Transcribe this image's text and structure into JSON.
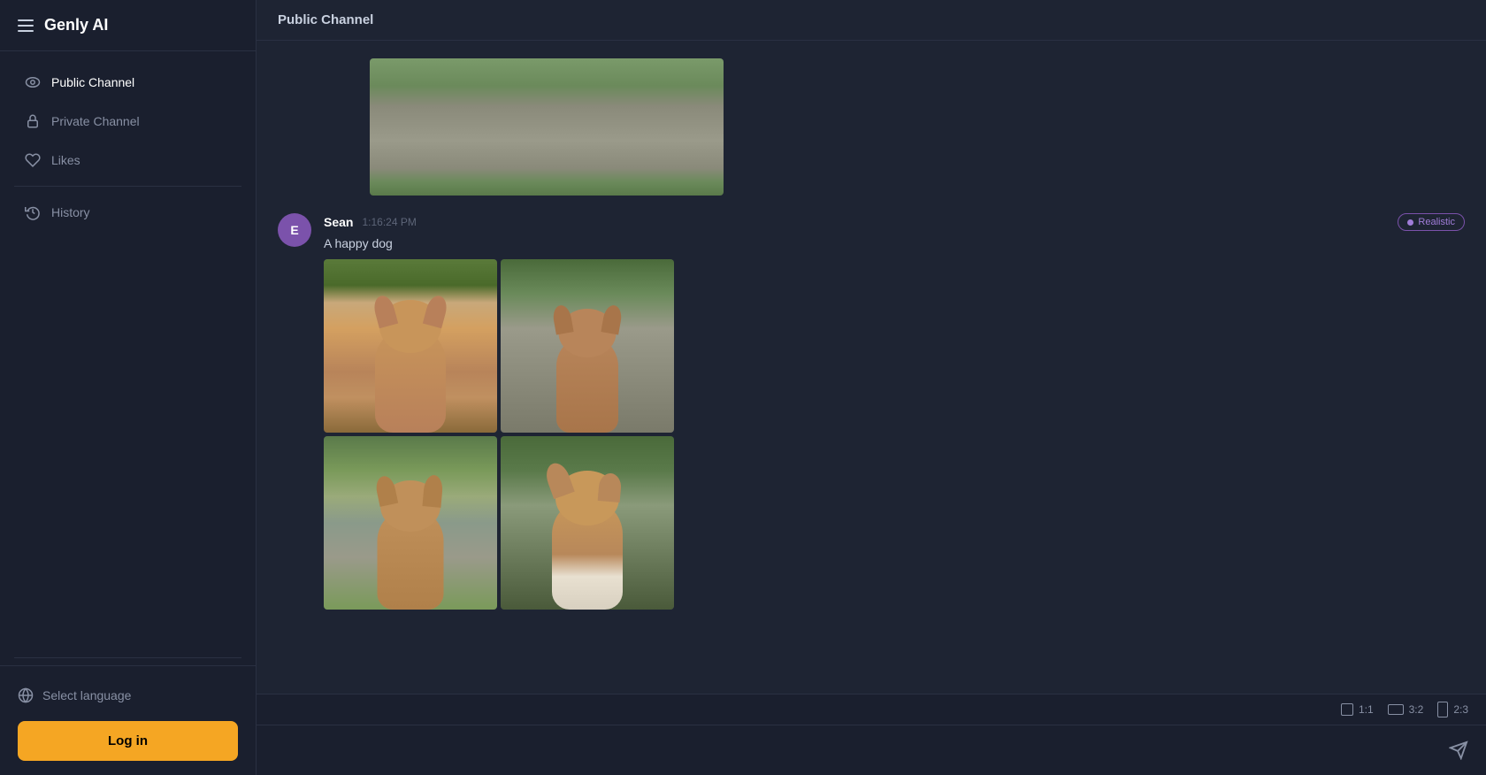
{
  "app": {
    "title": "Genly AI"
  },
  "sidebar": {
    "nav_items": [
      {
        "id": "public-channel",
        "label": "Public Channel",
        "icon": "eye"
      },
      {
        "id": "private-channel",
        "label": "Private Channel",
        "icon": "lock"
      },
      {
        "id": "likes",
        "label": "Likes",
        "icon": "heart"
      },
      {
        "id": "history",
        "label": "History",
        "icon": "clock"
      }
    ],
    "footer": {
      "select_language_label": "Select language",
      "login_label": "Log in"
    }
  },
  "header": {
    "channel_title": "Public Channel"
  },
  "messages": [
    {
      "id": "msg1",
      "author": "Sean",
      "time": "1:16:24 PM",
      "avatar_letter": "E",
      "text": "A happy dog",
      "badge": "Realistic"
    }
  ],
  "aspect_ratios": [
    {
      "id": "1:1",
      "label": "1:1",
      "width": 14,
      "height": 14
    },
    {
      "id": "3:2",
      "label": "3:2",
      "width": 18,
      "height": 12
    },
    {
      "id": "2:3",
      "label": "2:3",
      "width": 12,
      "height": 18
    }
  ],
  "input": {
    "placeholder": ""
  }
}
